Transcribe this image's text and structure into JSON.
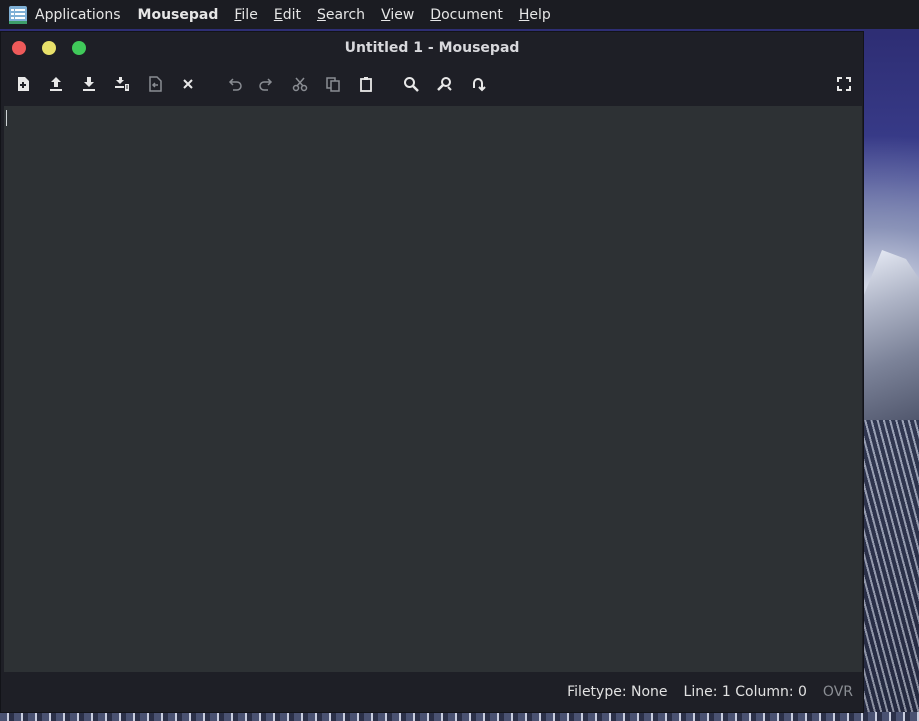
{
  "panel": {
    "applications_label": "Applications",
    "app_name": "Mousepad",
    "menus": [
      {
        "mnemonic": "F",
        "rest": "ile"
      },
      {
        "mnemonic": "E",
        "rest": "dit"
      },
      {
        "mnemonic": "S",
        "rest": "earch"
      },
      {
        "mnemonic": "V",
        "rest": "iew"
      },
      {
        "mnemonic": "D",
        "rest": "ocument"
      },
      {
        "mnemonic": "H",
        "rest": "elp"
      }
    ]
  },
  "window": {
    "title": "Untitled 1 - Mousepad"
  },
  "toolbar": {
    "buttons": [
      "new-document-icon",
      "open-file-icon",
      "save-icon",
      "save-as-icon",
      "revert-icon",
      "close-tab-icon",
      "undo-icon",
      "redo-icon",
      "cut-icon",
      "copy-icon",
      "paste-icon",
      "find-icon",
      "find-replace-icon",
      "go-to-line-icon",
      "fullscreen-icon"
    ]
  },
  "editor": {
    "content": ""
  },
  "statusbar": {
    "filetype": "Filetype: None",
    "position": "Line: 1 Column: 0",
    "mode": "OVR"
  },
  "colors": {
    "close": "#ee5a5a",
    "minimize": "#e8e06a",
    "maximize": "#40c95a",
    "editor_bg": "#2d3134",
    "window_bg": "#1e1f26"
  }
}
